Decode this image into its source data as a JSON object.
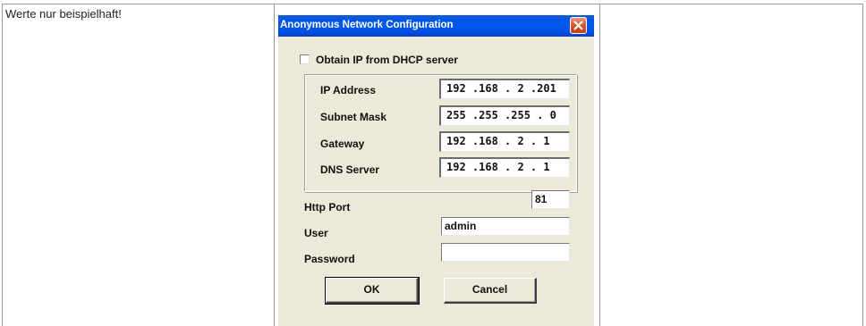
{
  "note": "Werte nur beispielhaft!",
  "dialog": {
    "title": "Anonymous Network Configuration",
    "dhcp_checkbox_label": "Obtain IP from DHCP server",
    "dhcp_checked": false,
    "ip_address_label": "IP Address",
    "ip_address_value": "192 .168 . 2 .201",
    "subnet_mask_label": "Subnet Mask",
    "subnet_mask_value": "255 .255 .255 . 0",
    "gateway_label": "Gateway",
    "gateway_value": "192 .168 . 2 . 1",
    "dns_server_label": "DNS Server",
    "dns_server_value": "192 .168 . 2 . 1",
    "http_port_label": "Http Port",
    "http_port_value": "81",
    "user_label": "User",
    "user_value": "admin",
    "password_label": "Password",
    "password_value": "",
    "ok_label": "OK",
    "cancel_label": "Cancel"
  },
  "colors": {
    "titlebar": "#0058ee",
    "dialog_bg": "#ece9d8",
    "close_button": "#d8572f"
  },
  "icons": {
    "close": "close-icon"
  }
}
